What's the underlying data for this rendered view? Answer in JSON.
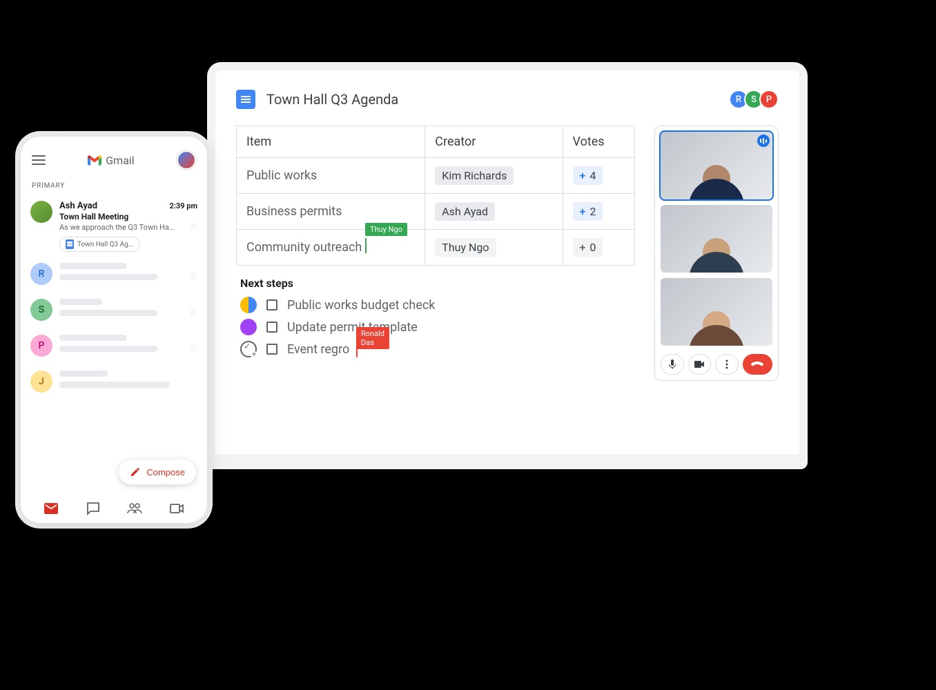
{
  "phone": {
    "brand": "Gmail",
    "primary_label": "PRIMARY",
    "email": {
      "sender": "Ash Ayad",
      "time": "2:39 pm",
      "subject": "Town Hall Meeting",
      "preview": "As we approach the Q3 Town Ha...",
      "attachment": "Town Hall Q3 Ag..."
    },
    "skeleton_avatars": [
      "R",
      "S",
      "P",
      "J"
    ],
    "compose": "Compose"
  },
  "doc": {
    "title": "Town Hall Q3 Agenda",
    "collaborators": [
      "R",
      "S",
      "P"
    ],
    "table": {
      "headers": {
        "item": "Item",
        "creator": "Creator",
        "votes": "Votes"
      },
      "rows": [
        {
          "item": "Public works",
          "creator": "Kim Richards",
          "votes": "4",
          "vote_style": "blue"
        },
        {
          "item": "Business permits",
          "creator": "Ash Ayad",
          "votes": "2",
          "vote_style": "blue"
        },
        {
          "item": "Community outreach",
          "creator": "Thuy Ngo",
          "votes": "0",
          "vote_style": "gray"
        }
      ]
    },
    "cursors": {
      "green": "Thuy Ngo",
      "red": "Ronald Das"
    },
    "next_steps_title": "Next steps",
    "steps": [
      {
        "text": "Public works budget check"
      },
      {
        "text": "Update permit template"
      },
      {
        "text": "Event regro"
      }
    ]
  },
  "colors": {
    "blue": "#4285f4",
    "green": "#34a853",
    "red": "#ea4335",
    "yellow": "#fbbc04",
    "gray": "#5f6368"
  }
}
